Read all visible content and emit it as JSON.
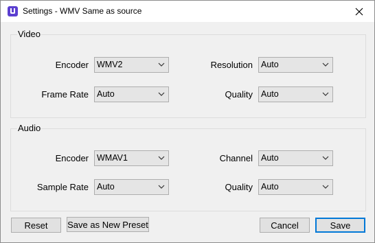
{
  "window": {
    "title": "Settings - WMV Same as source"
  },
  "video": {
    "group_label": "Video",
    "encoder": {
      "label": "Encoder",
      "value": "WMV2"
    },
    "resolution": {
      "label": "Resolution",
      "value": "Auto"
    },
    "frame_rate": {
      "label": "Frame Rate",
      "value": "Auto"
    },
    "quality": {
      "label": "Quality",
      "value": "Auto"
    }
  },
  "audio": {
    "group_label": "Audio",
    "encoder": {
      "label": "Encoder",
      "value": "WMAV1"
    },
    "channel": {
      "label": "Channel",
      "value": "Auto"
    },
    "sample_rate": {
      "label": "Sample Rate",
      "value": "Auto"
    },
    "quality": {
      "label": "Quality",
      "value": "Auto"
    }
  },
  "buttons": {
    "reset": "Reset",
    "save_as_preset": "Save as New Preset",
    "cancel": "Cancel",
    "save": "Save"
  },
  "icons": {
    "app": "app-logo-icon",
    "close": "close-icon",
    "dropdown": "chevron-down-icon"
  },
  "colors": {
    "accent": "#0078d7",
    "app_icon": "#5b3fd0"
  }
}
